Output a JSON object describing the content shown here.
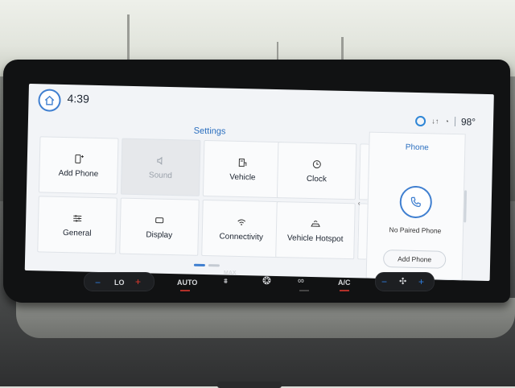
{
  "topbar": {
    "time": "4:39",
    "temperature": "98°"
  },
  "settings": {
    "title": "Settings",
    "tiles": [
      {
        "label": "Add Phone",
        "icon": "add-phone-icon",
        "enabled": true
      },
      {
        "label": "Sound",
        "icon": "speaker-icon",
        "enabled": false
      },
      {
        "label": "Vehicle",
        "icon": "vehicle-icon",
        "enabled": true
      },
      {
        "label": "Clock",
        "icon": "clock-icon",
        "enabled": true
      },
      {
        "label": "General",
        "icon": "sliders-icon",
        "enabled": true
      },
      {
        "label": "Display",
        "icon": "display-icon",
        "enabled": true
      },
      {
        "label": "Connectivity",
        "icon": "wifi-icon",
        "enabled": true
      },
      {
        "label": "Vehicle Hotspot",
        "icon": "hotspot-icon",
        "enabled": true
      }
    ]
  },
  "phone": {
    "title": "Phone",
    "status": "No Paired Phone",
    "add_button": "Add Phone"
  },
  "climate": {
    "temp_setting": "LO",
    "auto": "AUTO",
    "max_defrost": "MAX",
    "ac": "A/C"
  },
  "colors": {
    "accent": "#3f7fd0",
    "title_blue": "#2b6fbf",
    "indicator_red": "#e23a2e"
  }
}
